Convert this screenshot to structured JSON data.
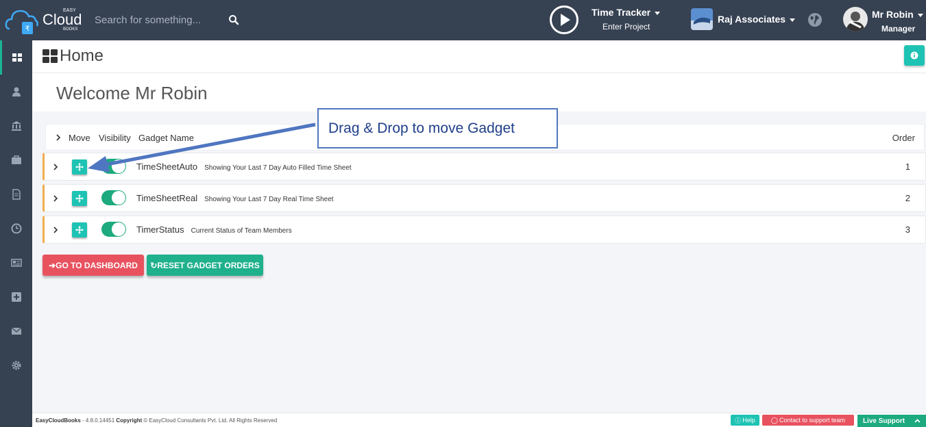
{
  "brand": {
    "easy": "EASY",
    "cloud": "Cloud",
    "books": "BOOKS"
  },
  "search": {
    "placeholder": "Search for something..."
  },
  "time_tracker": {
    "title": "Time Tracker",
    "subtitle": "Enter Project"
  },
  "company": {
    "name": "Raj Associates"
  },
  "user": {
    "name": "Mr Robin",
    "role": "Manager"
  },
  "sidebar": {
    "items": [
      {
        "icon": "dashboard-icon"
      },
      {
        "icon": "user-icon"
      },
      {
        "icon": "bank-icon"
      },
      {
        "icon": "briefcase-icon"
      },
      {
        "icon": "document-icon"
      },
      {
        "icon": "clock-icon"
      },
      {
        "icon": "newspaper-icon"
      },
      {
        "icon": "plus-square-icon"
      },
      {
        "icon": "envelope-icon"
      },
      {
        "icon": "gear-icon"
      }
    ]
  },
  "page": {
    "title": "Home",
    "welcome": "Welcome Mr Robin"
  },
  "table": {
    "headers": {
      "move": "Move",
      "visibility": "Visibility",
      "name": "Gadget Name",
      "order": "Order"
    },
    "rows": [
      {
        "name": "TimeSheetAuto",
        "desc": "Showing Your Last 7 Day Auto Filled Time Sheet",
        "order": "1",
        "visible": true
      },
      {
        "name": "TimeSheetReal",
        "desc": "Showing Your Last 7 Day Real Time Sheet",
        "order": "2",
        "visible": true
      },
      {
        "name": "TimerStatus",
        "desc": "Current Status of Team Members",
        "order": "3",
        "visible": true
      }
    ]
  },
  "buttons": {
    "dashboard": "GO TO DASHBOARD",
    "reset": "RESET GADGET ORDERS"
  },
  "callout": {
    "text": "Drag & Drop to move Gadget"
  },
  "footer": {
    "product": "EasyCloudBooks",
    "version": " - 4.8.0.14451 ",
    "copyright_label": "Copyright",
    "copyright_text": " © EasyCloud Consultants Pvt. Ltd. All Rights Reserved",
    "help": "Help",
    "support": "Contact to support team",
    "live": "Live Support"
  },
  "colors": {
    "topbar": "#364152",
    "teal": "#1ec3b3",
    "green": "#1caa7e",
    "red": "#e8525f",
    "orange": "#f0ad4e"
  }
}
